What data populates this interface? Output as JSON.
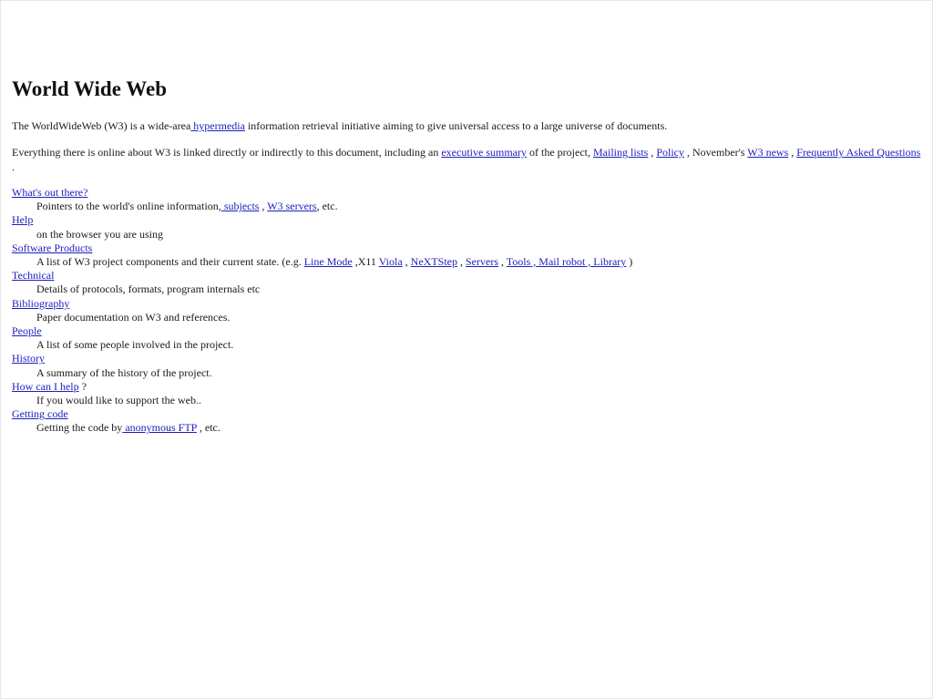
{
  "heading": "World Wide Web",
  "intro": {
    "text_before": "The WorldWideWeb (W3) is a wide-area",
    "link_hypermedia": " hypermedia",
    "text_after": " information retrieval initiative aiming to give universal access to a large universe of documents."
  },
  "summary": {
    "text_before": "Everything there is online about W3 is linked directly or indirectly to this document, including an ",
    "link_executive_summary": "executive summary",
    "text_mid1": " of the project, ",
    "link_mailing_lists": "Mailing lists",
    "sep1": " , ",
    "link_policy": "Policy",
    "text_mid2": " , November's ",
    "link_w3_news": "W3 news",
    "sep2": " , ",
    "link_faq": "Frequently Asked Questions",
    "text_end": " ."
  },
  "items": {
    "whats_out_there": {
      "title": "What's out there?",
      "desc_before": "Pointers to the world's online information,",
      "link_subjects": " subjects",
      "sep1": " , ",
      "link_w3_servers": "W3 servers",
      "desc_after": ", etc."
    },
    "help": {
      "title": "Help",
      "desc": "on the browser you are using"
    },
    "software_products": {
      "title": "Software Products",
      "desc_before": "A list of W3 project components and their current state. (e.g. ",
      "link_line_mode": "Line Mode",
      "text_x11": " ,X11 ",
      "link_viola": "Viola",
      "sep1": " , ",
      "link_nextstep": "NeXTStep",
      "sep2": " , ",
      "link_servers": "Servers",
      "sep3": " , ",
      "link_tools": "Tools",
      "sep4": " ,",
      "link_mail_robot": " Mail robot",
      "sep5": " ,",
      "link_library": " Library",
      "desc_after": " )"
    },
    "technical": {
      "title": "Technical",
      "desc": "Details of protocols, formats, program internals etc"
    },
    "bibliography": {
      "title": "Bibliography",
      "desc": "Paper documentation on W3 and references."
    },
    "people": {
      "title": "People",
      "desc": "A list of some people involved in the project."
    },
    "history": {
      "title": "History",
      "desc": "A summary of the history of the project."
    },
    "how_can_i_help": {
      "title": "How can I help",
      "title_suffix": " ?",
      "desc": "If you would like to support the web.."
    },
    "getting_code": {
      "title": "Getting code",
      "desc_before": "Getting the code by",
      "link_anonymous_ftp": " anonymous FTP",
      "desc_after": " , etc."
    }
  },
  "colors": {
    "link": "#1e1ebe",
    "text": "#1a1a1a",
    "background": "#ffffff"
  }
}
